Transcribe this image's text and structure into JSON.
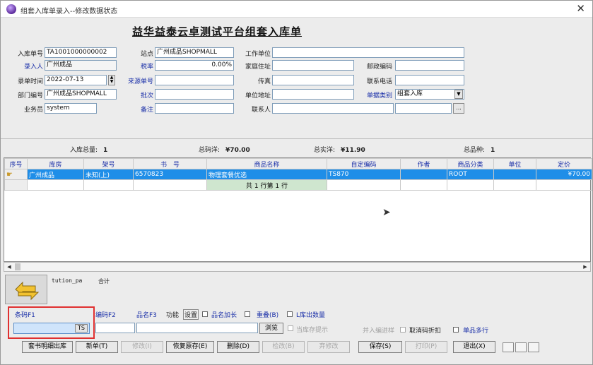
{
  "window": {
    "title": "组套入库单录入--修改数据状态",
    "close_glyph": "✕"
  },
  "form": {
    "title": "益华益泰云卓测试平台组套入库单",
    "fields": {
      "inbound_no": {
        "label": "入库单号",
        "value": "TA1001000000002"
      },
      "entry_person": {
        "label": "录入人",
        "value": "广州成品"
      },
      "entry_date": {
        "label": "录单时间",
        "value": "2022-07-13"
      },
      "dept_code": {
        "label": "部门编号",
        "value": "广州成品SHOPMALL"
      },
      "salesperson": {
        "label": "业务员",
        "value": "system"
      },
      "site": {
        "label": "站点",
        "value": "广州成品SHOPMALL"
      },
      "tax_rate": {
        "label": "税率",
        "value": "0.00%"
      },
      "source_no": {
        "label": "来源单号",
        "value": ""
      },
      "batch": {
        "label": "批次",
        "value": ""
      },
      "remark": {
        "label": "备注",
        "value": ""
      },
      "work_unit": {
        "label": "工作单位",
        "value": ""
      },
      "home_address": {
        "label": "家庭住址",
        "value": ""
      },
      "fax": {
        "label": "传真",
        "value": ""
      },
      "unit_address": {
        "label": "单位地址",
        "value": ""
      },
      "contact": {
        "label": "联系人",
        "value": ""
      },
      "postal_code": {
        "label": "邮政编码",
        "value": ""
      },
      "phone": {
        "label": "联系电话",
        "value": ""
      },
      "doc_type": {
        "label": "单据类别",
        "value": "组套入库"
      },
      "dots_glyph": "..."
    }
  },
  "summary": {
    "inbound_total": {
      "label": "入库总量:",
      "value": "1"
    },
    "total_price": {
      "label": "总码洋:",
      "value": "¥70.00"
    },
    "total_actual": {
      "label": "总实洋:",
      "value": "¥11.90"
    },
    "total_kinds": {
      "label": "总品种:",
      "value": "1"
    }
  },
  "grid": {
    "columns": [
      "序号",
      "库房",
      "架号",
      "书　号",
      "商品名称",
      "自定编码",
      "作者",
      "商品分类",
      "单位",
      "定价"
    ],
    "rows": [
      [
        "广州成品",
        "未知(上)",
        "6570823",
        "物理套餐优选",
        "TS870",
        "",
        "ROOT",
        "",
        "¥70.00"
      ]
    ],
    "page_info": "共 1 行第 1 行"
  },
  "footer": {
    "user": "tution_pa",
    "total_label": "合计",
    "barcode_label": "条码F1",
    "barcode_badge": "TS",
    "code_label": "编码F2",
    "name_label": "品名F3",
    "func_label": "功能",
    "settings_label": "设置",
    "name_plus_label": "品名加长",
    "reprint_label": "重叠(B)",
    "qty_label": "L库出数量",
    "browse_label": "浏览",
    "stock_prompt_label": "当库存提示",
    "enter_label": "并入编进样",
    "discount_label": "取消码折扣",
    "single_row_label": "单品多行",
    "buttons": {
      "set_book": "套书明细出库",
      "new": "新单(T)",
      "modify": "修改(I)",
      "restore": "恢复原存(E)",
      "delete": "删除(D)",
      "audit": "检改(B)",
      "cancel_audit": "弃修改",
      "save": "保存(S)",
      "print": "打印(P)",
      "exit": "退出(X)"
    }
  }
}
